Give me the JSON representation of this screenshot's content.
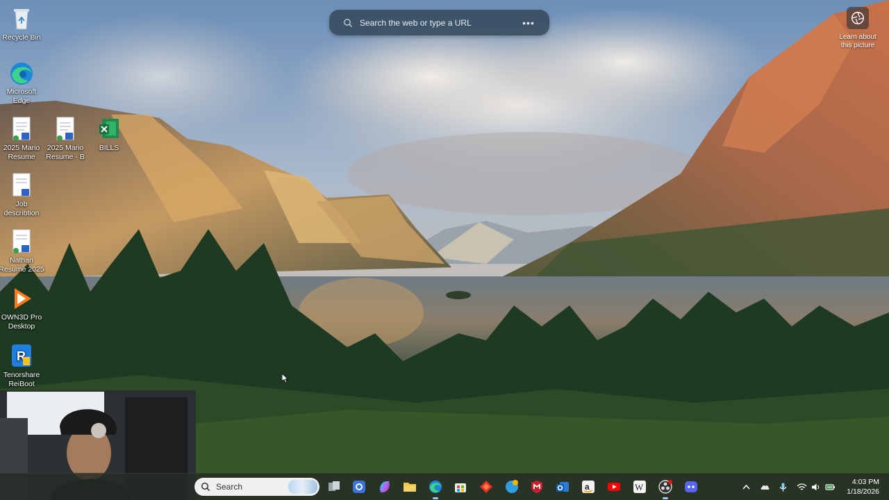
{
  "web_search": {
    "placeholder": "Search the web or type a URL",
    "more_icon": "more-dots-icon"
  },
  "spotlight": {
    "label": "Learn about this picture",
    "icon": "camera-lens-icon"
  },
  "desktop_icons": [
    {
      "label": "Recycle Bin",
      "icon": "recycle-bin-icon"
    },
    {
      "label": "Microsoft Edge",
      "icon": "edge-icon"
    },
    {
      "label": "2025 Mario Resume",
      "icon": "word-document-icon"
    },
    {
      "label": "2025 Mario Resume - B",
      "icon": "word-document-icon"
    },
    {
      "label": "BILLS",
      "icon": "excel-icon"
    },
    {
      "label": "Job describtion",
      "icon": "word-document-icon"
    },
    {
      "label": "Nathan Resume 2025",
      "icon": "word-document-icon"
    },
    {
      "label": "OWN3D Pro Desktop",
      "icon": "own3d-icon"
    },
    {
      "label": "Tenorshare ReiBoot",
      "icon": "reiboot-icon"
    }
  ],
  "taskbar": {
    "search_label": "Search",
    "apps": [
      {
        "name": "task-view-icon"
      },
      {
        "name": "chrome-like-icon"
      },
      {
        "name": "copilot-icon"
      },
      {
        "name": "file-explorer-icon"
      },
      {
        "name": "edge-icon"
      },
      {
        "name": "microsoft-store-icon"
      },
      {
        "name": "red-diamond-app-icon"
      },
      {
        "name": "globe-app-icon"
      },
      {
        "name": "mcafee-icon"
      },
      {
        "name": "outlook-icon"
      },
      {
        "name": "amazon-icon"
      },
      {
        "name": "youtube-icon"
      },
      {
        "name": "wikipedia-icon"
      },
      {
        "name": "obs-icon"
      },
      {
        "name": "discord-icon"
      }
    ],
    "tray": [
      "chevron-up-icon",
      "onedrive-icon",
      "microphone-icon",
      "wifi-icon",
      "speaker-icon",
      "battery-icon"
    ],
    "time": "4:03 PM",
    "date": "1/18/2026"
  }
}
